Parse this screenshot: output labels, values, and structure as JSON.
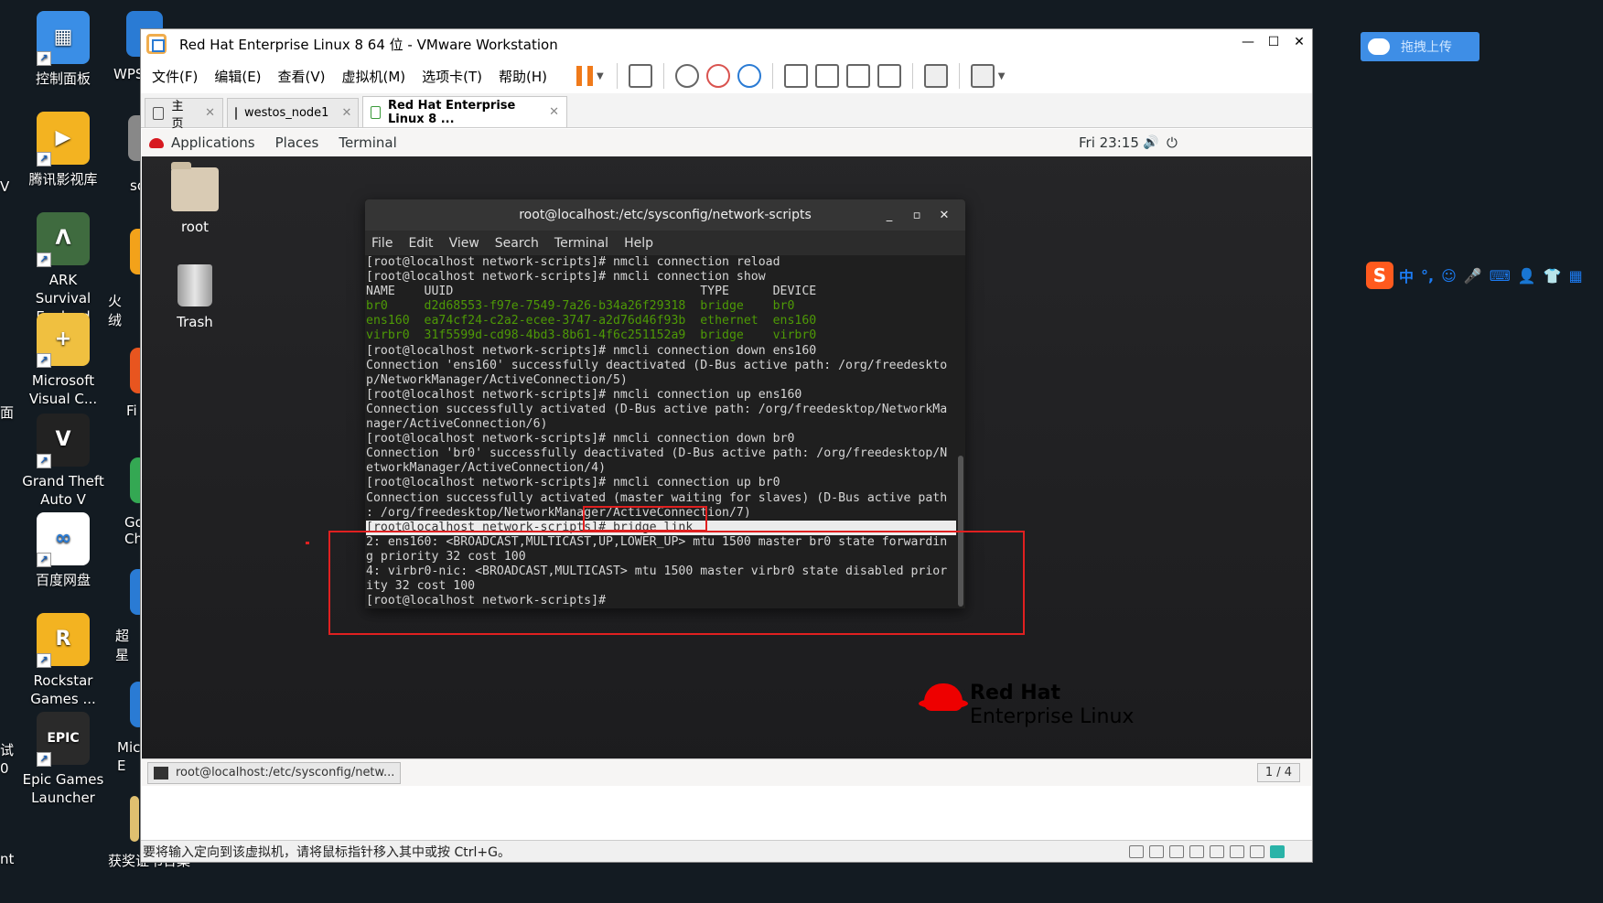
{
  "desktop": {
    "icons": [
      {
        "label": "控制面板",
        "color": "#3a8ee6",
        "glyph": "▦"
      },
      {
        "label": "腾讯影视库",
        "color": "#f3b321",
        "glyph": "▶"
      },
      {
        "label": "ARK Survival Evolved",
        "color": "#3f6b3f",
        "glyph": "Λ"
      },
      {
        "label": "Microsoft Visual C...",
        "color": "#f0c040",
        "glyph": "+"
      },
      {
        "label": "Grand Theft Auto V",
        "color": "#222222",
        "glyph": "V"
      },
      {
        "label": "百度网盘",
        "color": "#ffffff",
        "glyph": "∞"
      },
      {
        "label": "Rockstar Games ...",
        "color": "#f3b321",
        "glyph": "R"
      },
      {
        "label": "Epic Games Launcher",
        "color": "#2a2a2a",
        "glyph": "EPIC"
      }
    ],
    "partials_right": [
      "WPS",
      "so",
      "火绒",
      "Fi",
      "Go Ch",
      "超星",
      "Mic E",
      "获奖证书合集"
    ],
    "partials_left": [
      "V",
      "面",
      "试 0",
      "nt"
    ]
  },
  "upload_button": {
    "label": "拖拽上传"
  },
  "ime_toolbar": {
    "items": [
      "中",
      "°,",
      "☺",
      "🎤",
      "⌨",
      "👤",
      "👕",
      "▦"
    ]
  },
  "vmware": {
    "title": "Red Hat Enterprise Linux 8 64 位 - VMware Workstation",
    "window_controls": [
      "—",
      "☐",
      "✕"
    ],
    "menu": [
      "文件(F)",
      "编辑(E)",
      "查看(V)",
      "虚拟机(M)",
      "选项卡(T)",
      "帮助(H)"
    ],
    "tabs": [
      {
        "label": "主页",
        "close": "✕"
      },
      {
        "label": "westos_node1",
        "close": "✕"
      },
      {
        "label": "Red Hat Enterprise Linux 8 ...",
        "close": "✕"
      }
    ],
    "status_text": "要将输入定向到该虚拟机，请将鼠标指针移入其中或按 Ctrl+G。"
  },
  "guest": {
    "topbar": {
      "applications": "Applications",
      "places": "Places",
      "terminal": "Terminal",
      "clock": "Fri 23:15",
      "volume": "🔊",
      "power": "⏻"
    },
    "icons": [
      {
        "label": "root"
      },
      {
        "label": "Trash"
      }
    ],
    "logo": {
      "line1": "Red Hat",
      "line2": "Enterprise Linux"
    },
    "taskbar": {
      "item": "root@localhost:/etc/sysconfig/netw...",
      "workspace": "1 / 4"
    }
  },
  "terminal": {
    "title": "root@localhost:/etc/sysconfig/network-scripts",
    "controls": [
      "_",
      "▫",
      "✕"
    ],
    "menu": [
      "File",
      "Edit",
      "View",
      "Search",
      "Terminal",
      "Help"
    ],
    "lines": [
      {
        "text": "[root@localhost network-scripts]# nmcli connection reload",
        "style": "normal"
      },
      {
        "text": "[root@localhost network-scripts]# nmcli connection show",
        "style": "normal"
      },
      {
        "text": "NAME    UUID                                  TYPE      DEVICE",
        "style": "normal"
      },
      {
        "text": "br0     d2d68553-f97e-7549-7a26-b34a26f29318  bridge    br0",
        "style": "green"
      },
      {
        "text": "ens160  ea74cf24-c2a2-ecee-3747-a2d76d46f93b  ethernet  ens160",
        "style": "green"
      },
      {
        "text": "virbr0  31f5599d-cd98-4bd3-8b61-4f6c251152a9  bridge    virbr0",
        "style": "green"
      },
      {
        "text": "[root@localhost network-scripts]# nmcli connection down ens160",
        "style": "normal"
      },
      {
        "text": "Connection 'ens160' successfully deactivated (D-Bus active path: /org/freedeskto",
        "style": "normal"
      },
      {
        "text": "p/NetworkManager/ActiveConnection/5)",
        "style": "normal"
      },
      {
        "text": "[root@localhost network-scripts]# nmcli connection up ens160",
        "style": "normal"
      },
      {
        "text": "Connection successfully activated (D-Bus active path: /org/freedesktop/NetworkMa",
        "style": "normal"
      },
      {
        "text": "nager/ActiveConnection/6)",
        "style": "normal"
      },
      {
        "text": "[root@localhost network-scripts]# nmcli connection down br0",
        "style": "normal"
      },
      {
        "text": "Connection 'br0' successfully deactivated (D-Bus active path: /org/freedesktop/N",
        "style": "normal"
      },
      {
        "text": "etworkManager/ActiveConnection/4)",
        "style": "normal"
      },
      {
        "text": "[root@localhost network-scripts]# nmcli connection up br0",
        "style": "normal"
      },
      {
        "text": "Connection successfully activated (master waiting for slaves) (D-Bus active path",
        "style": "normal"
      },
      {
        "text": ": /org/freedesktop/NetworkManager/ActiveConnection/7)",
        "style": "normal"
      },
      {
        "text": "[root@localhost network-scripts]# bridge link",
        "style": "sel"
      },
      {
        "text": "2: ens160: <BROADCAST,MULTICAST,UP,LOWER_UP> mtu 1500 master br0 state forwardin",
        "style": "normal"
      },
      {
        "text": "g priority 32 cost 100",
        "style": "normal"
      },
      {
        "text": "4: virbr0-nic: <BROADCAST,MULTICAST> mtu 1500 master virbr0 state disabled prior",
        "style": "normal"
      },
      {
        "text": "ity 32 cost 100",
        "style": "normal"
      },
      {
        "text": "[root@localhost network-scripts]#",
        "style": "normal"
      }
    ]
  },
  "colors": {
    "annotation_red": "#e02020",
    "term_green": "#4e9a06",
    "redhat_red": "#ee0000"
  }
}
